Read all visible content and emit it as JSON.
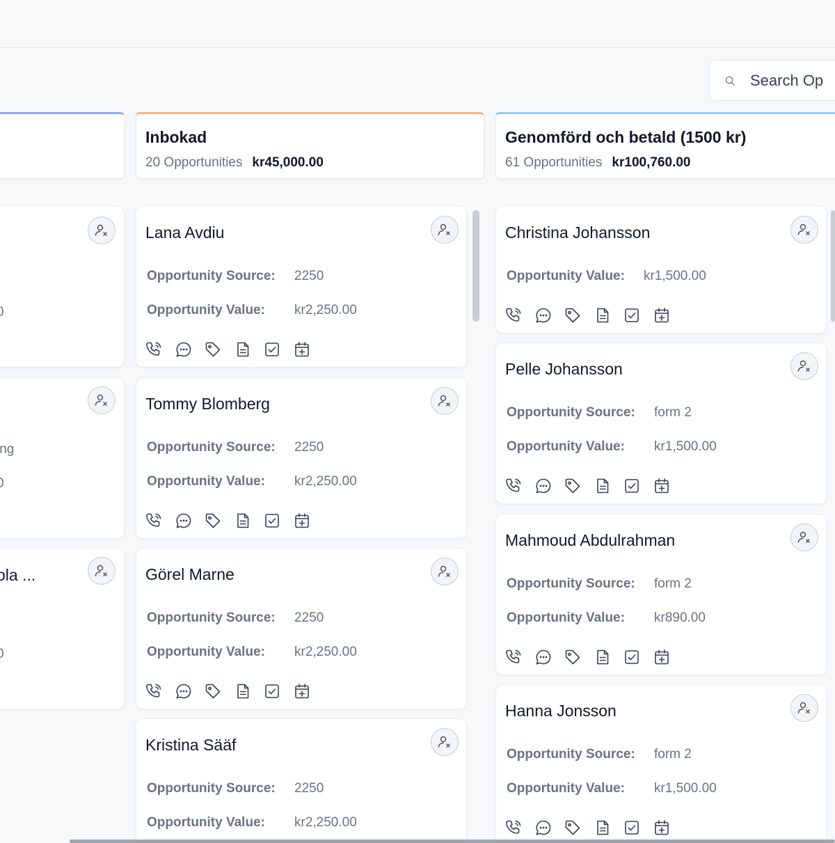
{
  "search": {
    "placeholder": "Search Op"
  },
  "colors": {
    "stage_left": "#93a8e8",
    "stage_middle": "#e9b98a",
    "stage_right": "#9ccbea"
  },
  "left_column": {
    "partials": [
      "0",
      "ing",
      "0",
      "ola ...",
      "0"
    ]
  },
  "stages": [
    {
      "title": "Inbokad",
      "count": "20 Opportunities",
      "amount": "kr45,000.00"
    },
    {
      "title": "Genomförd och betald (1500 kr)",
      "count": "61 Opportunities",
      "amount": "kr100,760.00"
    }
  ],
  "middle_cards": [
    {
      "name": "Lana Avdiu",
      "source_label": "Opportunity Source:",
      "source": "2250",
      "value_label": "Opportunity Value:",
      "value": "kr2,250.00"
    },
    {
      "name": "Tommy Blomberg",
      "source_label": "Opportunity Source:",
      "source": "2250",
      "value_label": "Opportunity Value:",
      "value": "kr2,250.00"
    },
    {
      "name": "Görel Marne",
      "source_label": "Opportunity Source:",
      "source": "2250",
      "value_label": "Opportunity Value:",
      "value": "kr2,250.00"
    },
    {
      "name": "Kristina Sääf",
      "source_label": "Opportunity Source:",
      "source": "2250",
      "value_label": "Opportunity Value:",
      "value": "kr2,250.00"
    }
  ],
  "right_cards": [
    {
      "name": "Christina Johansson",
      "value_label": "Opportunity Value:",
      "value": "kr1,500.00"
    },
    {
      "name": "Pelle Johansson",
      "source_label": "Opportunity Source:",
      "source": "form 2",
      "value_label": "Opportunity Value:",
      "value": "kr1,500.00"
    },
    {
      "name": "Mahmoud Abdulrahman",
      "source_label": "Opportunity Source:",
      "source": "form 2",
      "value_label": "Opportunity Value:",
      "value": "kr890.00"
    },
    {
      "name": "Hanna Jonsson",
      "source_label": "Opportunity Source:",
      "source": "form 2",
      "value_label": "Opportunity Value:",
      "value": "kr1,500.00"
    }
  ],
  "action_icons": [
    "phone-icon",
    "chat-icon",
    "tag-icon",
    "note-icon",
    "task-icon",
    "calendar-add-icon"
  ]
}
